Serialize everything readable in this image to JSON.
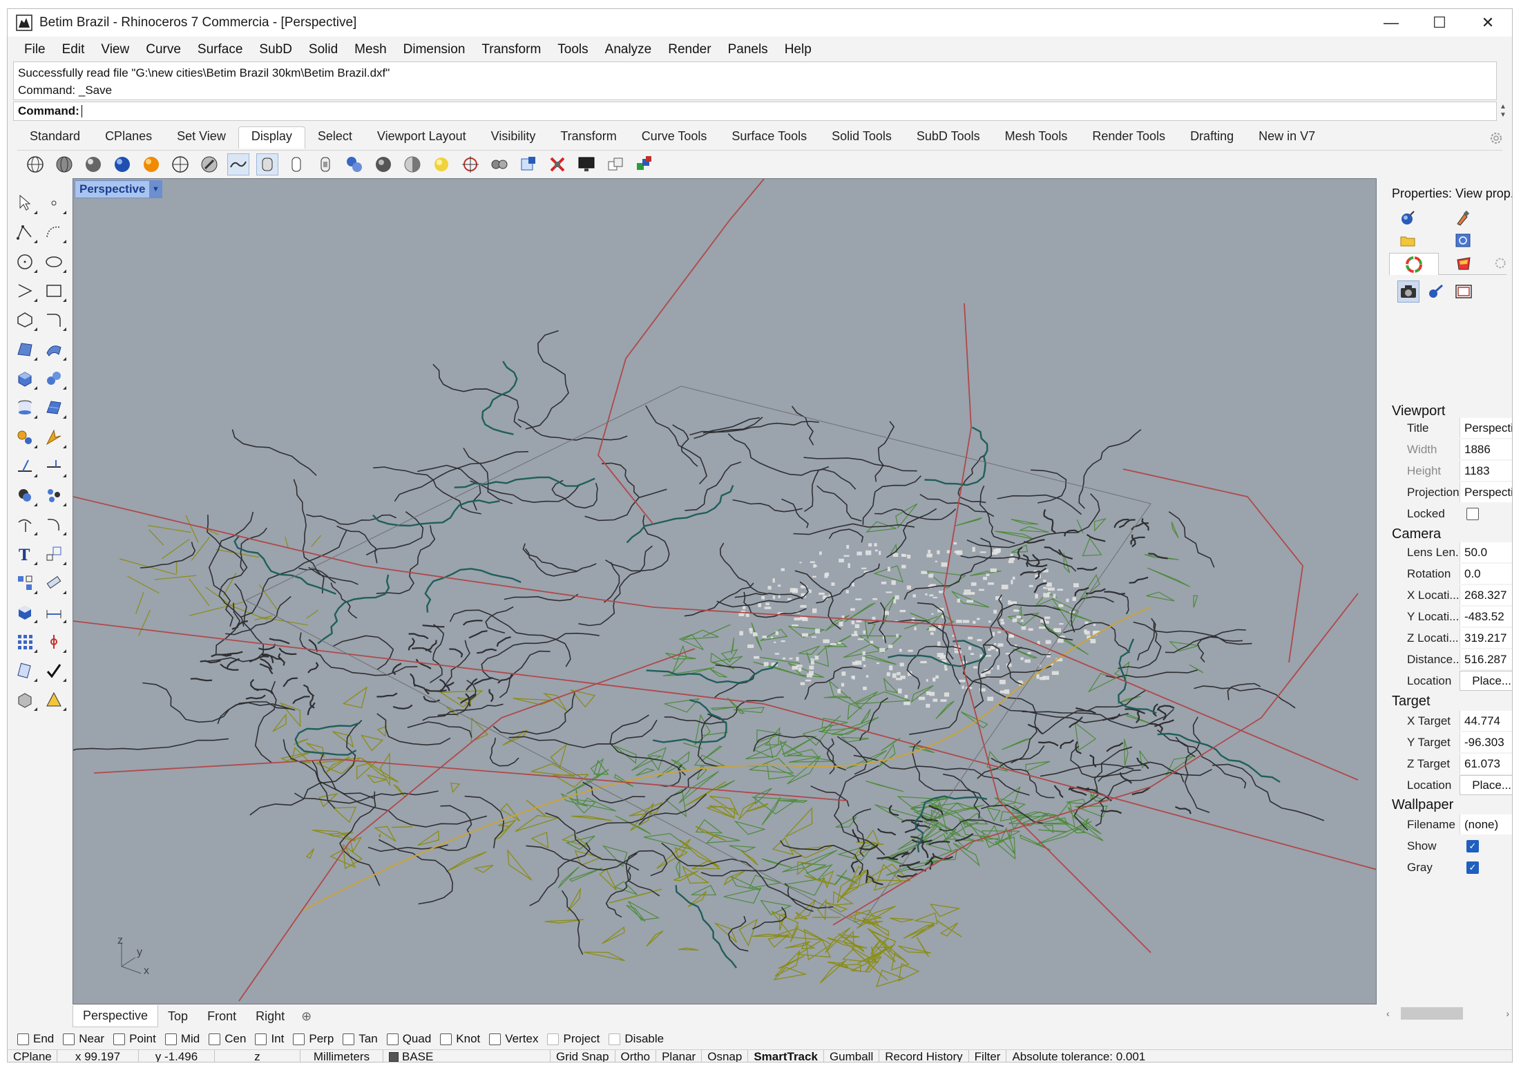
{
  "window": {
    "title": "Betim Brazil - Rhinoceros 7 Commercia - [Perspective]",
    "minimize": "—",
    "maximize": "☐",
    "close": "✕"
  },
  "menu": [
    "File",
    "Edit",
    "View",
    "Curve",
    "Surface",
    "SubD",
    "Solid",
    "Mesh",
    "Dimension",
    "Transform",
    "Tools",
    "Analyze",
    "Render",
    "Panels",
    "Help"
  ],
  "command": {
    "history": [
      "Successfully read file \"G:\\new cities\\Betim Brazil 30km\\Betim Brazil.dxf\"",
      "Command: _Save"
    ],
    "prompt": "Command:",
    "value": ""
  },
  "toolbar_tabs": {
    "items": [
      "Standard",
      "CPlanes",
      "Set View",
      "Display",
      "Select",
      "Viewport Layout",
      "Visibility",
      "Transform",
      "Curve Tools",
      "Surface Tools",
      "Solid Tools",
      "SubD Tools",
      "Mesh Tools",
      "Render Tools",
      "Drafting",
      "New in V7"
    ],
    "active": "Display"
  },
  "viewport": {
    "title": "Perspective",
    "axes": {
      "z": "z",
      "y": "y",
      "x": "x"
    }
  },
  "viewport_tabs": {
    "items": [
      "Perspective",
      "Top",
      "Front",
      "Right"
    ],
    "active": "Perspective",
    "add": "⊕"
  },
  "properties": {
    "title": "Properties: View prop...",
    "viewport": {
      "heading": "Viewport",
      "title_label": "Title",
      "title_value": "Perspective",
      "width_label": "Width",
      "width_value": "1886",
      "height_label": "Height",
      "height_value": "1183",
      "projection_label": "Projection",
      "projection_value": "Perspective",
      "locked_label": "Locked",
      "locked": false
    },
    "camera": {
      "heading": "Camera",
      "lens_label": "Lens Len...",
      "lens_value": "50.0",
      "rotation_label": "Rotation",
      "rotation_value": "0.0",
      "xloc_label": "X Locati...",
      "xloc_value": "268.327",
      "yloc_label": "Y Locati...",
      "yloc_value": "-483.52",
      "zloc_label": "Z Locati...",
      "zloc_value": "319.217",
      "distance_label": "Distance...",
      "distance_value": "516.287",
      "location_label": "Location",
      "location_button": "Place..."
    },
    "target": {
      "heading": "Target",
      "x_label": "X Target",
      "x_value": "44.774",
      "y_label": "Y Target",
      "y_value": "-96.303",
      "z_label": "Z Target",
      "z_value": "61.073",
      "location_label": "Location",
      "location_button": "Place..."
    },
    "wallpaper": {
      "heading": "Wallpaper",
      "filename_label": "Filename",
      "filename_value": "(none)",
      "show_label": "Show",
      "show": true,
      "gray_label": "Gray",
      "gray": true
    }
  },
  "osnap": [
    {
      "label": "End",
      "checked": false
    },
    {
      "label": "Near",
      "checked": false
    },
    {
      "label": "Point",
      "checked": false
    },
    {
      "label": "Mid",
      "checked": false
    },
    {
      "label": "Cen",
      "checked": false
    },
    {
      "label": "Int",
      "checked": false
    },
    {
      "label": "Perp",
      "checked": false
    },
    {
      "label": "Tan",
      "checked": false
    },
    {
      "label": "Quad",
      "checked": false
    },
    {
      "label": "Knot",
      "checked": false
    },
    {
      "label": "Vertex",
      "checked": false
    },
    {
      "label": "Project",
      "checked": false
    },
    {
      "label": "Disable",
      "checked": false
    }
  ],
  "status": {
    "cplane": "CPlane",
    "x": "x 99.197",
    "y": "y -1.496",
    "z": "z",
    "units": "Millimeters",
    "layer": "BASE",
    "grid_snap": "Grid Snap",
    "ortho": "Ortho",
    "planar": "Planar",
    "osnap": "Osnap",
    "smarttrack": "SmartTrack",
    "gumball": "Gumball",
    "record_history": "Record History",
    "filter": "Filter",
    "tolerance": "Absolute tolerance: 0.001"
  },
  "colors": {
    "viewport_bg": "#9ba3ad",
    "road_dark": "#2e2f31",
    "road_red": "#b04848",
    "veg_green": "#4d8b3a",
    "veg_olive": "#8a8d12",
    "water_teal": "#1f5f5a",
    "urban_white": "#e3e3e1",
    "active_blue": "#a9c4ef"
  }
}
